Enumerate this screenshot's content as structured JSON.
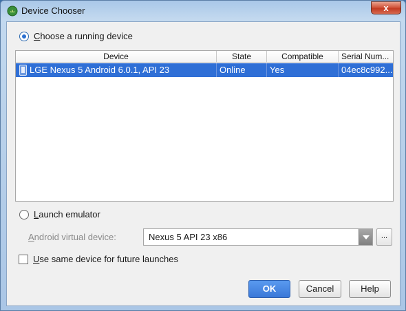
{
  "window": {
    "title": "Device Chooser",
    "close_glyph": "x"
  },
  "running": {
    "radio_label_prefix": "C",
    "radio_label_rest": "hoose a running device",
    "selected": true
  },
  "table": {
    "columns": [
      "Device",
      "State",
      "Compatible",
      "Serial Num..."
    ],
    "rows": [
      {
        "device": "LGE Nexus 5 Android 6.0.1, API 23",
        "state": "Online",
        "compatible": "Yes",
        "serial": "04ec8c992..."
      }
    ]
  },
  "emulator": {
    "radio_label_prefix": "L",
    "radio_label_rest": "aunch emulator",
    "avd_label_prefix": "A",
    "avd_label_rest": "ndroid virtual device:",
    "avd_value": "Nexus 5 API 23 x86",
    "ellipsis": "..."
  },
  "same_device": {
    "label_prefix": "U",
    "label_rest": "se same device for future launches"
  },
  "buttons": {
    "ok": "OK",
    "cancel": "Cancel",
    "help": "Help"
  },
  "colors": {
    "selection": "#2f6fd6",
    "primary_button": "#3a78d8"
  }
}
